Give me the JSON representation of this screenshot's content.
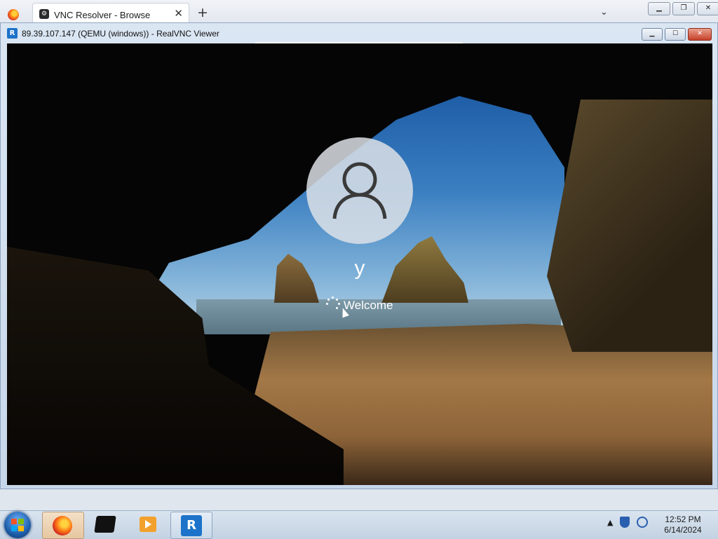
{
  "browser": {
    "tab_title": "VNC Resolver - Browse",
    "tab_close_glyph": "✕",
    "new_tab_glyph": "+",
    "tab_list_glyph": "⌄"
  },
  "vnc_window": {
    "icon_label": "R",
    "title": "89.39.107.147 (QEMU (windows)) - RealVNC Viewer"
  },
  "lock_screen": {
    "user_name": "y",
    "status_text": "Welcome"
  },
  "taskbar": {
    "apps": [
      {
        "name": "firefox",
        "active": true
      },
      {
        "name": "terminal",
        "active": false
      },
      {
        "name": "media-player",
        "active": false
      },
      {
        "name": "vnc-viewer",
        "active": true
      }
    ],
    "vnc_glyph": "R",
    "tray_arrow": "▲",
    "clock_time": "12:52 PM",
    "clock_date": "6/14/2024"
  },
  "icons": {
    "start": "windows-logo-icon",
    "firefox": "firefox-icon",
    "terminal": "terminal-icon",
    "media": "media-player-icon",
    "vnc": "realvnc-icon",
    "shield": "shield-icon",
    "network": "network-icon"
  }
}
